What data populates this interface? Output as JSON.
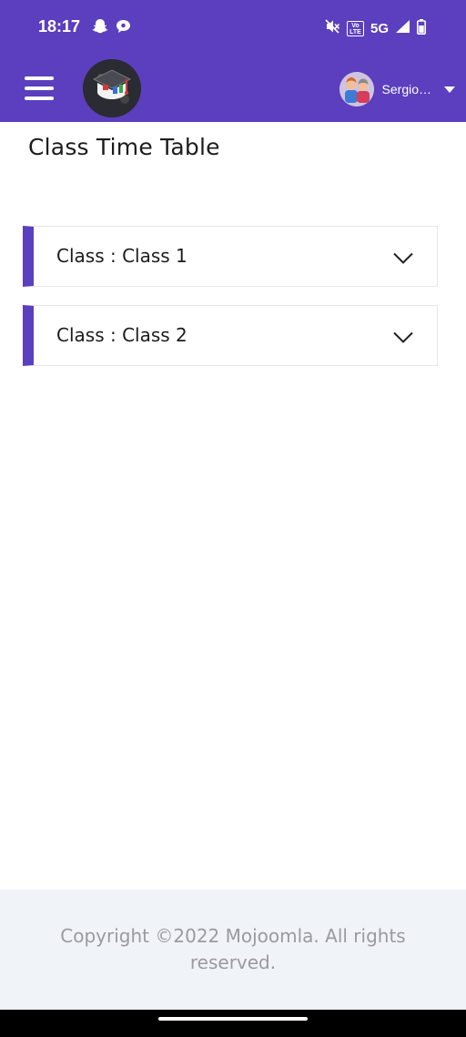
{
  "status_bar": {
    "time": "18:17",
    "network": "5G",
    "volte": "Vo LTE",
    "icons": [
      "snapchat-icon",
      "chat-bubble-icon",
      "mute-icon",
      "volte-icon",
      "signal-icon",
      "battery-icon"
    ]
  },
  "header": {
    "user_name": "Sergio…",
    "menu_icon": "hamburger-menu-icon",
    "logo_icon": "graduation-cap-logo",
    "brand_color": "#5b3fbe"
  },
  "page": {
    "title": "Class Time Table"
  },
  "classes": [
    {
      "label": "Class : Class 1"
    },
    {
      "label": "Class : Class 2"
    }
  ],
  "footer": {
    "copyright": "Copyright ©2022 Mojoomla. All rights reserved."
  }
}
